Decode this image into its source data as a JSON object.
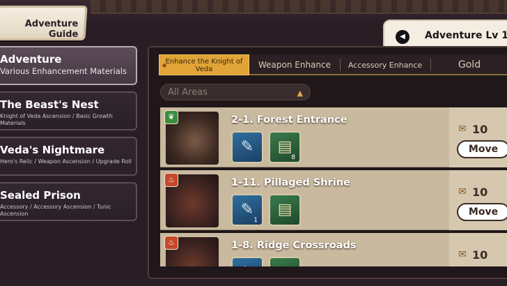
{
  "header": {
    "guide_title": "Adventure Guide",
    "level_label": "Adventure Lv 1"
  },
  "sidebar": {
    "items": [
      {
        "title": "Adventure",
        "subtitle": "Various Enhancement Materials",
        "active": true
      },
      {
        "title": "The Beast's Nest",
        "subtitle": "Knight of Veda Ascension / Basic Growth Materials",
        "active": false
      },
      {
        "title": "Veda's Nightmare",
        "subtitle": "Hero's Relic / Weapon Ascension / Upgrade Roll",
        "active": false
      },
      {
        "title": "Sealed Prison",
        "subtitle": "Accessory / Accessory Ascension / Tunic Ascension",
        "active": false
      }
    ]
  },
  "tabs": [
    {
      "label": "Enhance the Knight of Veda",
      "active": true
    },
    {
      "label": "Weapon Enhance",
      "active": false
    },
    {
      "label": "Accessory Enhance",
      "active": false
    },
    {
      "label": "Gold",
      "active": false
    }
  ],
  "filter": {
    "selected": "All Areas"
  },
  "stages": [
    {
      "name": "2-1. Forest Entrance",
      "element_icon": "nature-icon",
      "items": [
        {
          "icon": "blue-scroll-icon",
          "qty": ""
        },
        {
          "icon": "green-book-icon",
          "qty": "8"
        }
      ],
      "cost": "10",
      "button": "Move"
    },
    {
      "name": "1-11. Pillaged Shrine",
      "element_icon": "fire-icon",
      "items": [
        {
          "icon": "blue-scroll-icon",
          "qty": "1"
        },
        {
          "icon": "green-book-icon",
          "qty": ""
        }
      ],
      "cost": "10",
      "button": "Move"
    },
    {
      "name": "1-8. Ridge Crossroads",
      "element_icon": "fire-icon",
      "items": [
        {
          "icon": "blue-scroll-icon",
          "qty": ""
        },
        {
          "icon": "green-book-icon",
          "qty": ""
        }
      ],
      "cost": "10",
      "button": ""
    }
  ],
  "colors": {
    "accent_tab": "#e0a437",
    "row_bg": "#c8b99f",
    "background": "#2a1e24"
  }
}
